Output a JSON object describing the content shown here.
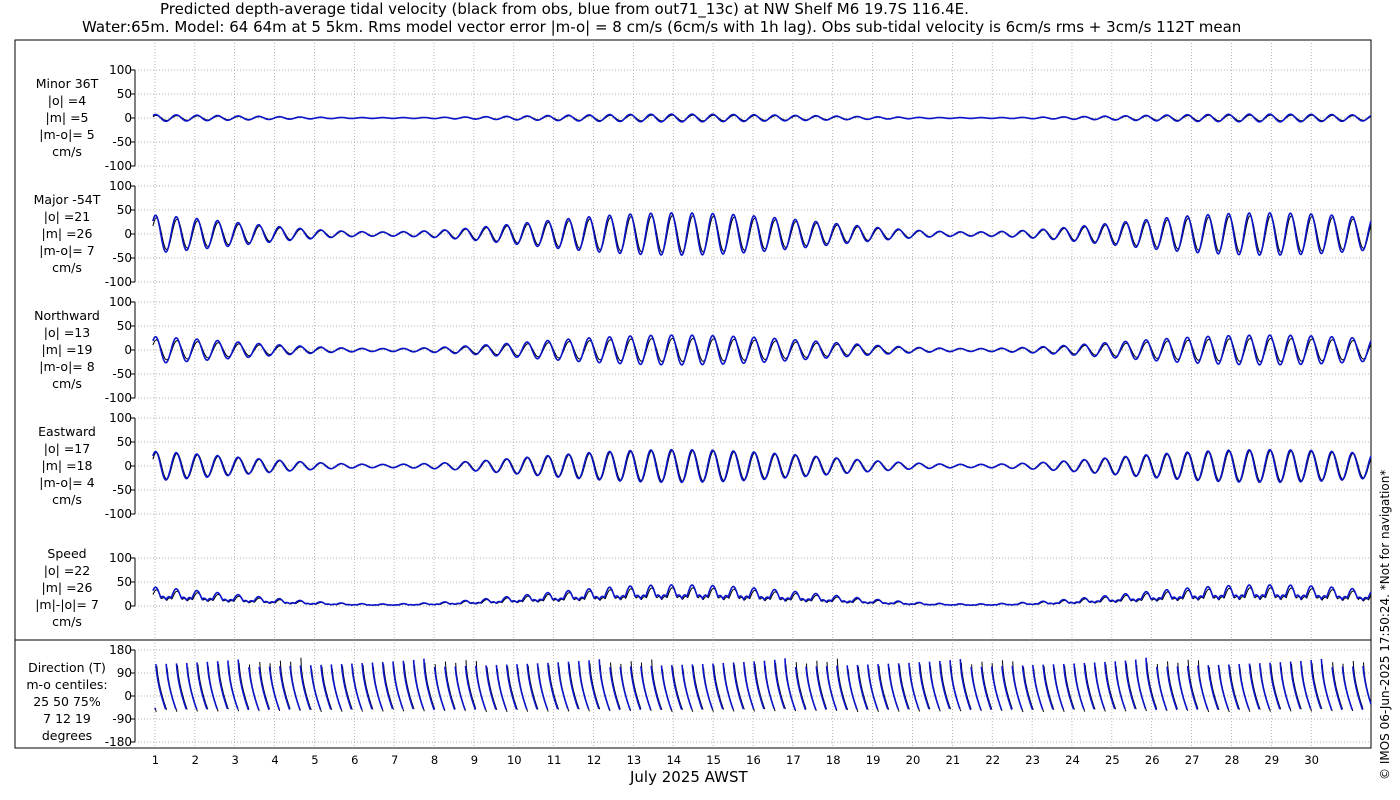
{
  "title_line1": "Predicted depth-average tidal velocity (black from obs, blue from out71_13c) at NW Shelf M6 19.7S 116.4E.",
  "title_line2": "Water:65m. Model: 64 64m at 5 5km. Rms model vector error |m-o| = 8 cm/s (6cm/s with 1h lag). Obs sub-tidal velocity is 6cm/s rms + 3cm/s 112T mean",
  "xlabel": "July 2025 AWST",
  "copyright": "© IMOS 06-Jun-2025 17:50:24. *Not for navigation*",
  "colors": {
    "obs": "#000000",
    "model": "#0a14c8",
    "grid": "#9a9a9a"
  },
  "chart_data": [
    {
      "type": "line",
      "panel": "minor",
      "labels": [
        "Minor 36T",
        "|o| =4",
        "|m| =5",
        "|m-o|= 5",
        "cm/s"
      ],
      "yticks": [
        100,
        50,
        0,
        -50,
        -100
      ],
      "ylim": [
        -100,
        100
      ],
      "xlim": [
        0,
        31
      ],
      "series": [
        {
          "role": "obs",
          "amplitude_cm_s": 6
        },
        {
          "role": "model",
          "amplitude_cm_s": 8
        }
      ]
    },
    {
      "type": "line",
      "panel": "major",
      "labels": [
        "Major -54T",
        "|o| =21",
        "|m| =26",
        "|m-o|= 7",
        "cm/s"
      ],
      "yticks": [
        100,
        50,
        0,
        -50,
        -100
      ],
      "ylim": [
        -100,
        100
      ],
      "xlim": [
        0,
        31
      ],
      "series": [
        {
          "role": "obs",
          "amplitude_cm_s": 38
        },
        {
          "role": "model",
          "amplitude_cm_s": 44
        }
      ]
    },
    {
      "type": "line",
      "panel": "northward",
      "labels": [
        "Northward",
        "|o| =13",
        "|m| =19",
        "|m-o|= 8",
        "cm/s"
      ],
      "yticks": [
        100,
        50,
        0,
        -50,
        -100
      ],
      "ylim": [
        -100,
        100
      ],
      "xlim": [
        0,
        31
      ],
      "series": [
        {
          "role": "obs",
          "amplitude_cm_s": 24
        },
        {
          "role": "model",
          "amplitude_cm_s": 31
        }
      ]
    },
    {
      "type": "line",
      "panel": "eastward",
      "labels": [
        "Eastward",
        "|o| =17",
        "|m| =18",
        "|m-o|= 4",
        "cm/s"
      ],
      "yticks": [
        100,
        50,
        0,
        -50,
        -100
      ],
      "ylim": [
        -100,
        100
      ],
      "xlim": [
        0,
        31
      ],
      "series": [
        {
          "role": "obs",
          "amplitude_cm_s": 32
        },
        {
          "role": "model",
          "amplitude_cm_s": 34
        }
      ]
    },
    {
      "type": "line",
      "panel": "speed",
      "labels": [
        "Speed",
        "|o| =22",
        "|m| =26",
        "|m|-|o|= 7",
        "cm/s"
      ],
      "yticks": [
        100,
        50,
        0
      ],
      "ylim": [
        0,
        100
      ],
      "xlim": [
        0,
        31
      ],
      "series": [
        {
          "role": "obs",
          "amplitude_cm_s": 38
        },
        {
          "role": "model",
          "amplitude_cm_s": 44
        }
      ]
    },
    {
      "type": "line",
      "panel": "direction",
      "labels": [
        "Direction (T)",
        "m-o centiles:",
        "25  50  75%",
        "7  12  19",
        "degrees"
      ],
      "yticks": [
        180,
        90,
        0,
        -90,
        -180
      ],
      "ylim": [
        -180,
        180
      ],
      "xlim": [
        0,
        31
      ],
      "series": [
        {
          "role": "obs"
        },
        {
          "role": "model"
        }
      ]
    }
  ],
  "xticks": [
    1,
    2,
    3,
    4,
    5,
    6,
    7,
    8,
    9,
    10,
    11,
    12,
    13,
    14,
    15,
    16,
    17,
    18,
    19,
    20,
    21,
    22,
    23,
    24,
    25,
    26,
    27,
    28,
    29,
    30
  ],
  "tidal_period_hours": 12.42,
  "spring_neap_period_days": 14.77
}
